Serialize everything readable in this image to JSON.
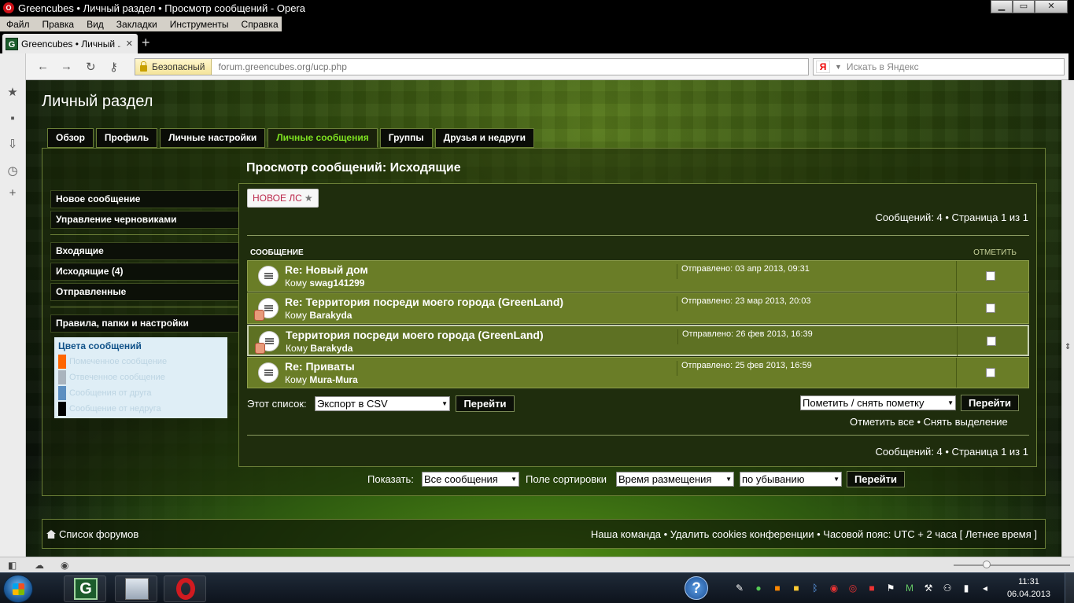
{
  "window": {
    "title": "Greencubes • Личный раздел • Просмотр сообщений - Opera"
  },
  "menu": [
    "Файл",
    "Правка",
    "Вид",
    "Закладки",
    "Инструменты",
    "Справка"
  ],
  "tab": {
    "title": "Greencubes • Личный ..."
  },
  "addressbar": {
    "secure_label": "Безопасный",
    "url": "forum.greencubes.org/ucp.php",
    "search_placeholder": "Искать в Яндекс"
  },
  "page": {
    "title": "Личный раздел",
    "tabs": [
      "Обзор",
      "Профиль",
      "Личные настройки",
      "Личные сообщения",
      "Группы",
      "Друзья и недруги"
    ],
    "active_tab": "Личные сообщения",
    "section_title": "Просмотр сообщений: Исходящие",
    "nav_group1": [
      "Новое сообщение",
      "Управление черновиками"
    ],
    "nav_group2": [
      "Входящие",
      "Исходящие (4)",
      "Отправленные"
    ],
    "nav_group3": [
      "Правила, папки и настройки"
    ],
    "colors": {
      "title": "Цвета сообщений",
      "items": [
        {
          "label": "Помеченное сообщение",
          "color": "#ff6600"
        },
        {
          "label": "Отвеченное сообщение",
          "color": "#aab4be"
        },
        {
          "label": "Сообщения от друга",
          "color": "#5c8fc1"
        },
        {
          "label": "Сообщение от недруга",
          "color": "#000000"
        }
      ]
    },
    "new_pm_label": "НОВОЕ ЛС",
    "count_top": "Сообщений: 4 • Страница 1 из 1",
    "count_bottom": "Сообщений: 4 • Страница 1 из 1",
    "col_message": "СООБЩЕНИЕ",
    "col_mark": "ОТМЕТИТЬ",
    "to_prefix": "Кому",
    "messages": [
      {
        "subject": "Re: Новый дом",
        "to": "swag141299",
        "sent": "Отправлено: 03 апр 2013, 09:31",
        "forwarded": false
      },
      {
        "subject": "Re: Территория посреди моего города (GreenLand)",
        "to": "Barakyda",
        "sent": "Отправлено: 23 мар 2013, 20:03",
        "forwarded": true
      },
      {
        "subject": "Территория посреди моего города (GreenLand)",
        "to": "Barakyda",
        "sent": "Отправлено: 26 фев 2013, 16:39",
        "forwarded": true
      },
      {
        "subject": "Re: Приваты",
        "to": "Mura-Mura",
        "sent": "Отправлено: 25 фев 2013, 16:59",
        "forwarded": false
      }
    ],
    "list_label": "Этот список:",
    "export_value": "Экспорт в CSV",
    "go_label": "Перейти",
    "mark_action_value": "Пометить / снять пометку",
    "mark_all": "Отметить все",
    "unmark_all": "Снять выделение",
    "bullet": "•",
    "show_label": "Показать:",
    "show_value": "Все сообщения",
    "sort_label": "Поле сортировки",
    "sort_value": "Время размещения",
    "order_value": "по убыванию",
    "forum_list": "Список форумов",
    "footer_right": "Наша команда • Удалить cookies конференции • Часовой пояс: UTC + 2 часа [ Летнее время ]"
  },
  "taskbar": {
    "time": "11:31",
    "date": "06.04.2013"
  }
}
